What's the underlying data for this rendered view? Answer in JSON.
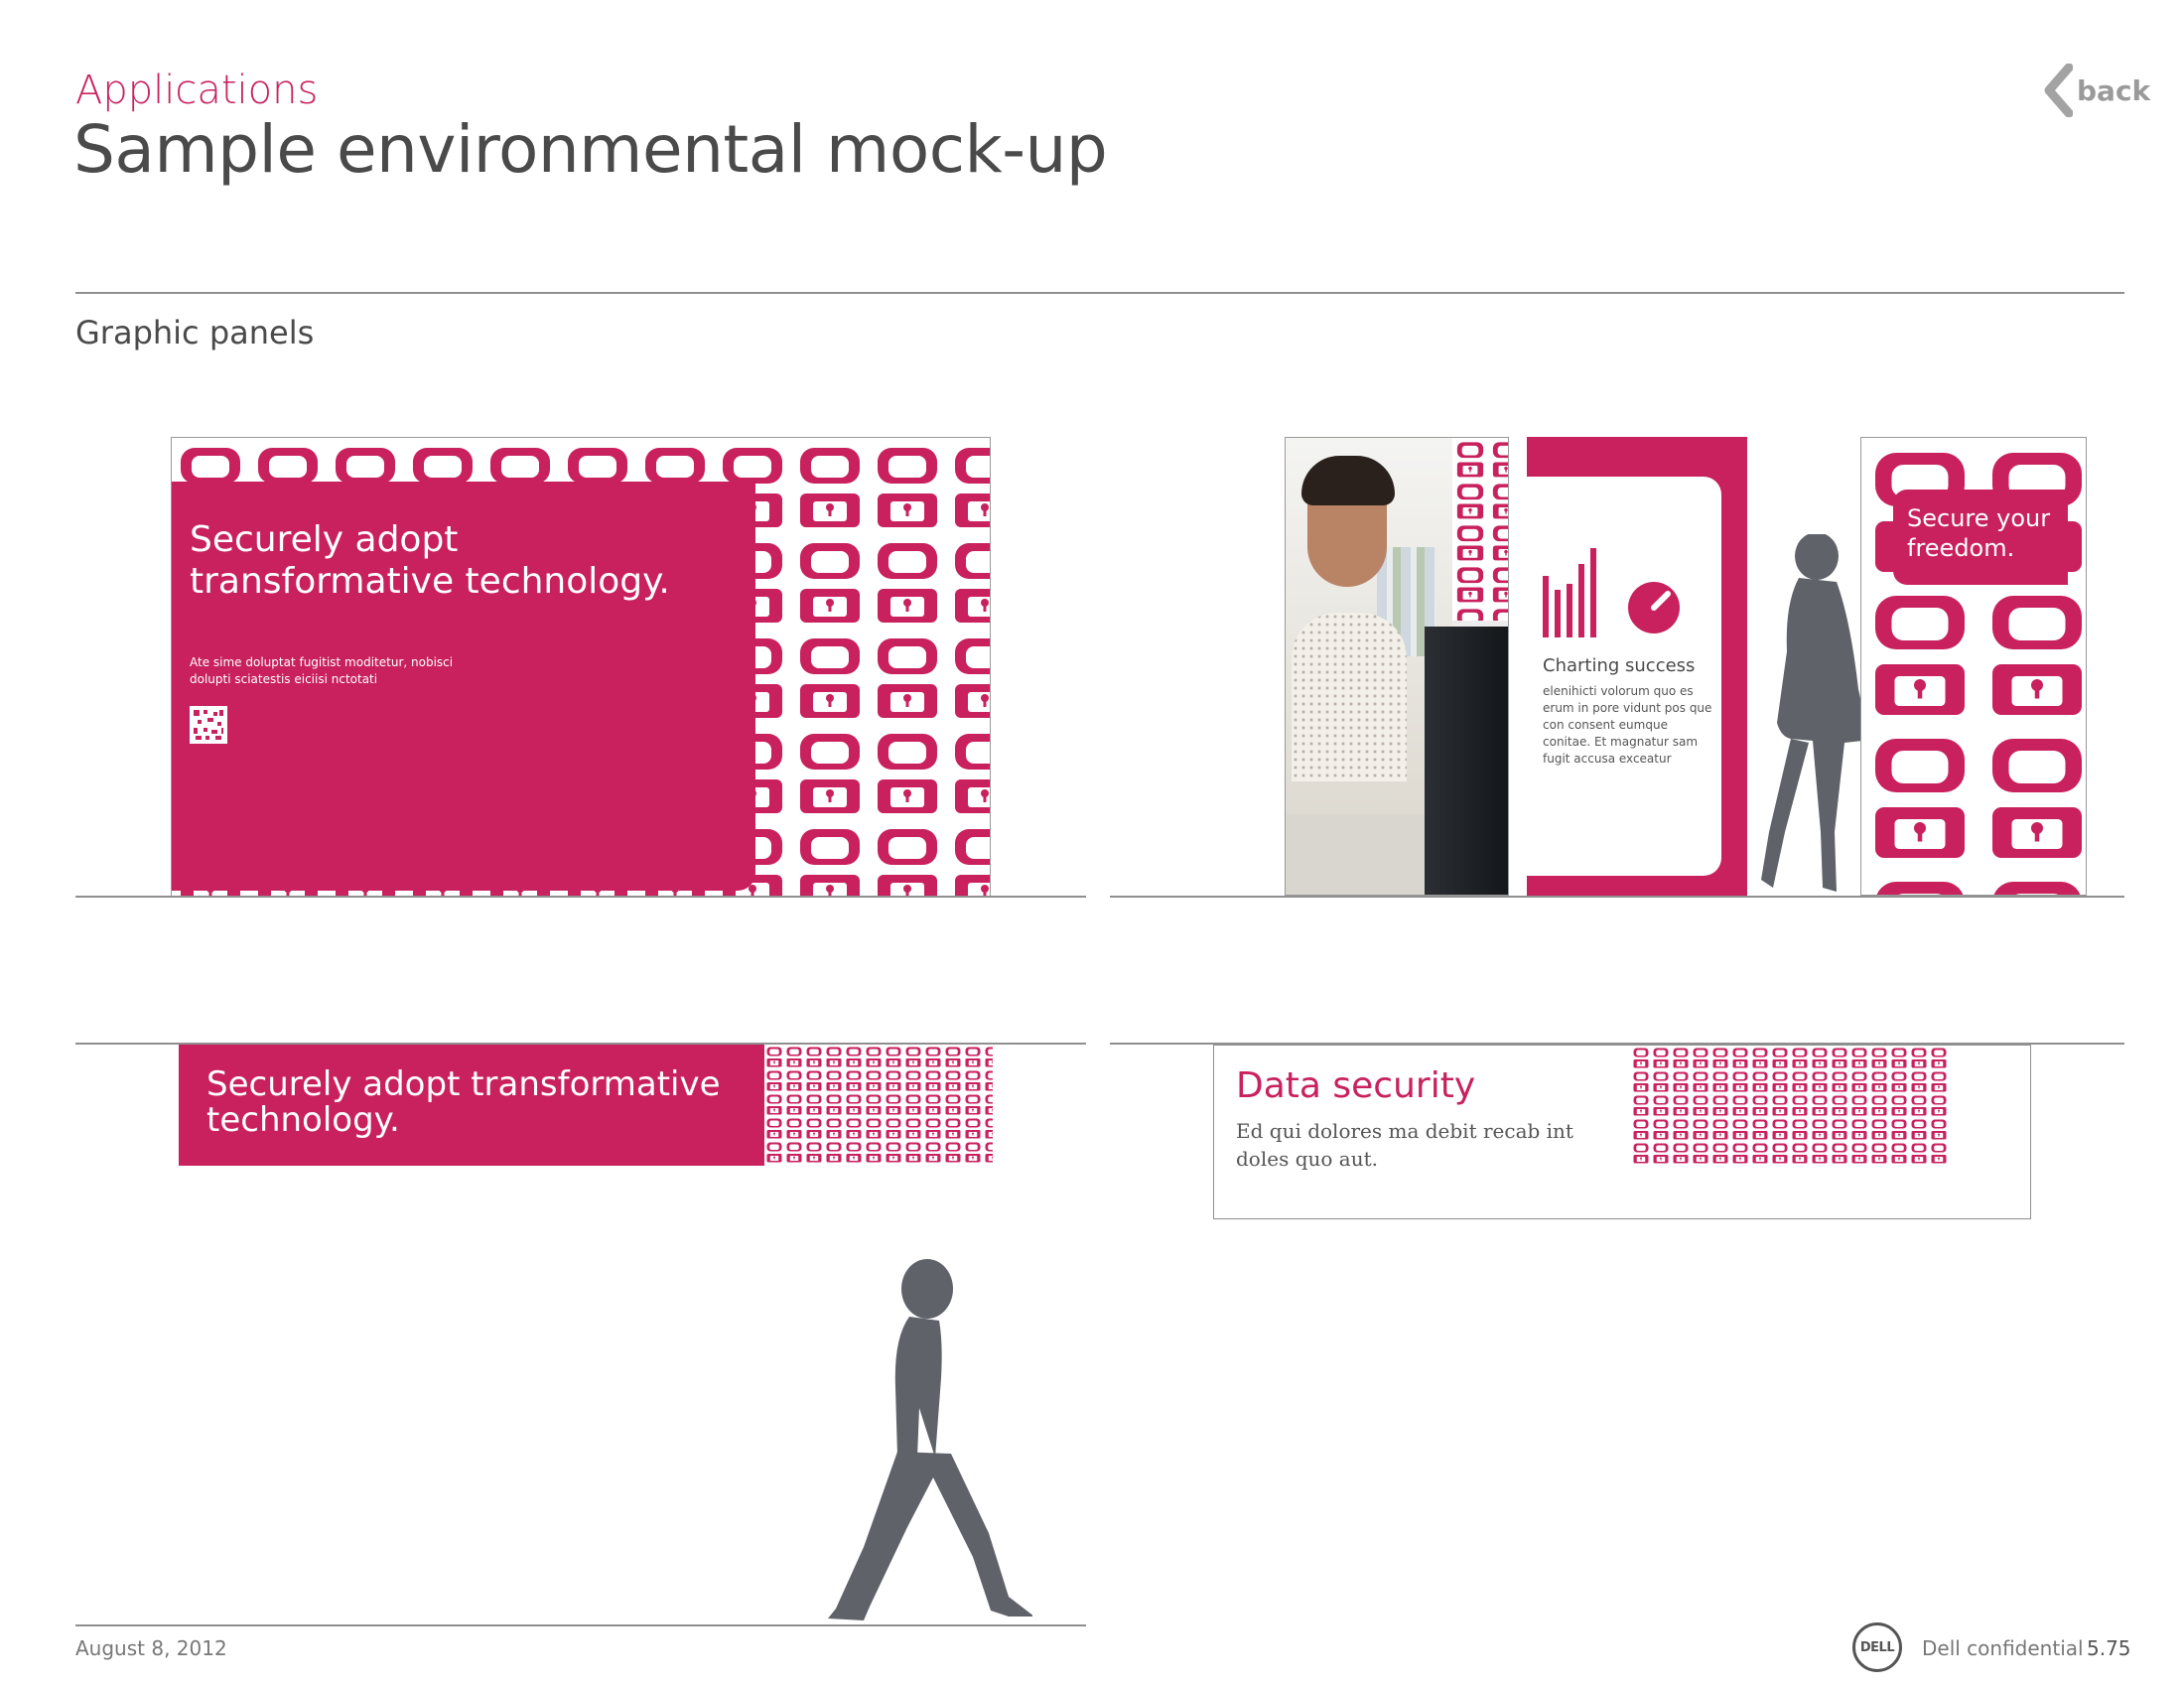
{
  "header": {
    "section": "Applications",
    "title": "Sample environmental mock-up",
    "back_label": "back"
  },
  "subsection": "Graphic panels",
  "panel_large": {
    "headline": "Securely adopt transformative technology.",
    "body": "Ate sime doluptat fugitist moditetur, nobisci dolupti sciatestis eiciisi nctotati"
  },
  "panel_triptych": {
    "chart_panel_title": "Charting success",
    "chart_panel_body": "elenihicti volorum quo es erum in pore vidunt pos que con consent eumque conitae. Et magnatur sam fugit accusa exceatur",
    "secure_panel_text": "Secure your freedom."
  },
  "banner_magenta": {
    "text": "Securely adopt transformative technology."
  },
  "banner_white": {
    "title": "Data security",
    "body": "Ed qui dolores ma debit recab int doles quo aut."
  },
  "footer": {
    "date": "August 8, 2012",
    "logo_text": "DELL",
    "confidential": "Dell confidential",
    "page_number": "5.75"
  },
  "colors": {
    "brand_magenta": "#c8215d",
    "text_gray": "#4a4a4a",
    "silhouette_gray": "#5f6269"
  }
}
